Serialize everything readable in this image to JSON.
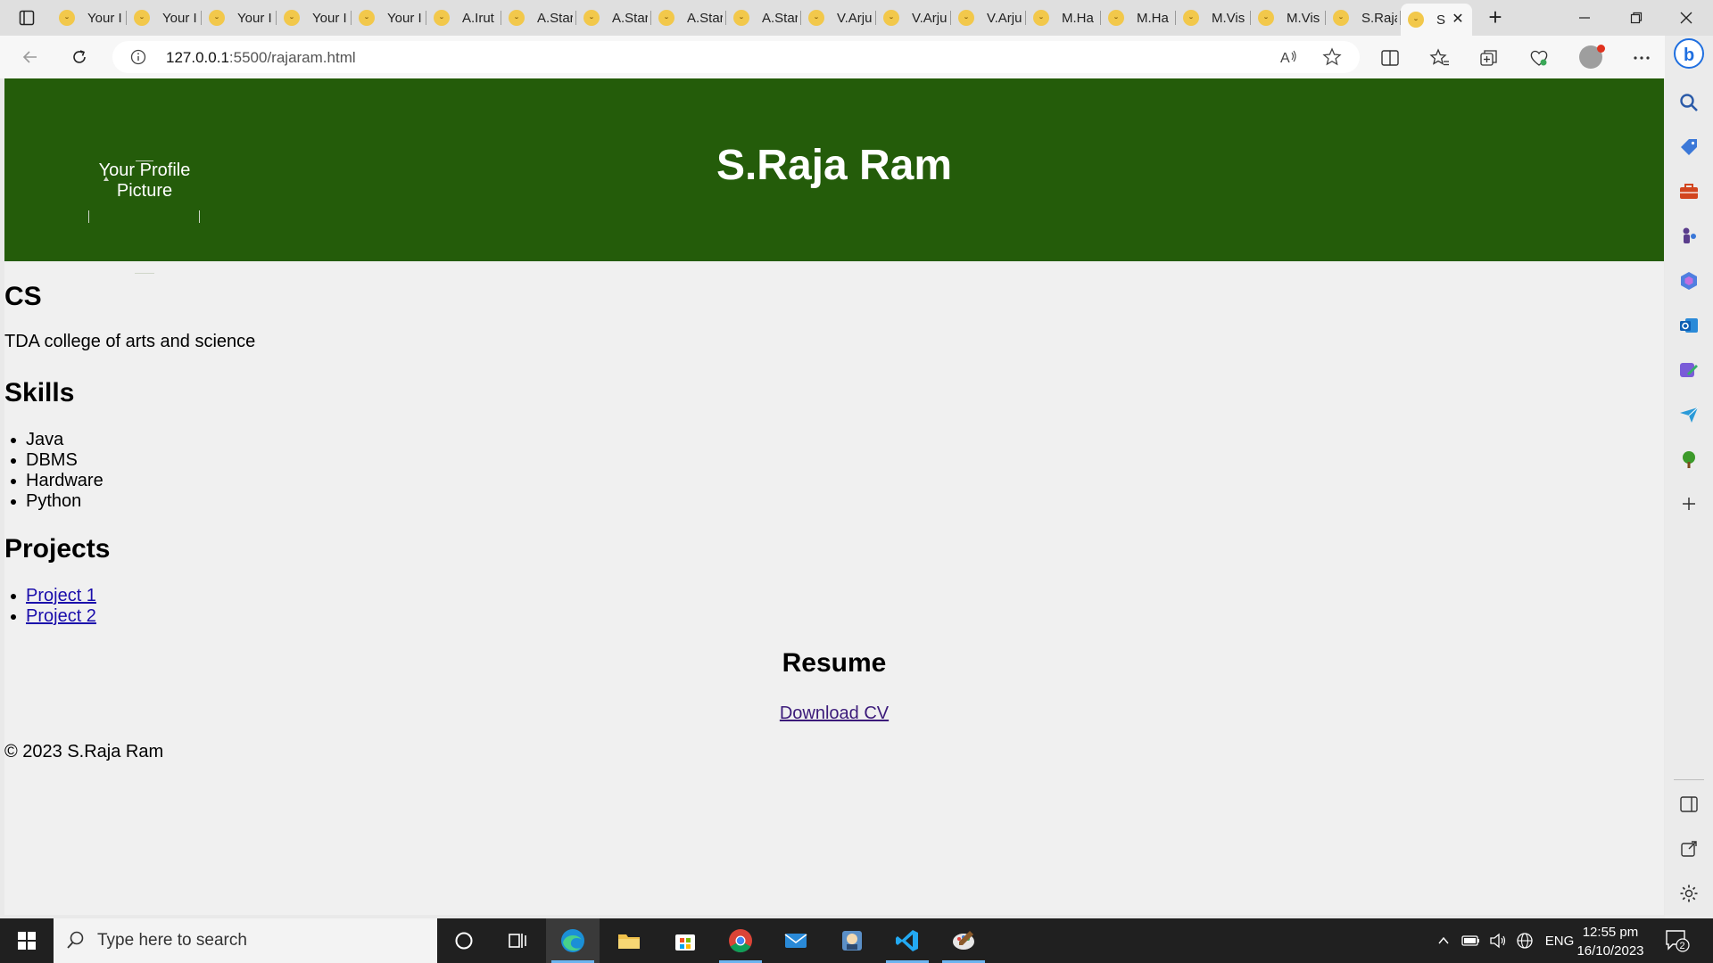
{
  "tabs": [
    {
      "label": "Your I"
    },
    {
      "label": "Your I"
    },
    {
      "label": "Your I"
    },
    {
      "label": "Your I"
    },
    {
      "label": "Your I"
    },
    {
      "label": "A.Irut"
    },
    {
      "label": "A.Star"
    },
    {
      "label": "A.Star"
    },
    {
      "label": "A.Star"
    },
    {
      "label": "A.Star"
    },
    {
      "label": "V.Arju"
    },
    {
      "label": "V.Arju"
    },
    {
      "label": "V.Arju"
    },
    {
      "label": "M.Ha"
    },
    {
      "label": "M.Ha"
    },
    {
      "label": "M.Vis"
    },
    {
      "label": "M.Vis"
    },
    {
      "label": "S.Raja"
    },
    {
      "label": "S"
    }
  ],
  "address_bar": {
    "host": "127.0.0.1",
    "path": ":5500/rajaram.html"
  },
  "page": {
    "title": "S.Raja Ram",
    "profile_picture_alt": "Your Profile Picture",
    "department": "CS",
    "college": "TDA college of arts and science",
    "skills_heading": "Skills",
    "skills": [
      "Java",
      "DBMS",
      "Hardware",
      "Python"
    ],
    "projects_heading": "Projects",
    "projects": [
      "Project 1",
      "Project 2"
    ],
    "resume_heading": "Resume",
    "download_cv": "Download CV",
    "footer": "© 2023 S.Raja Ram"
  },
  "taskbar": {
    "search_placeholder": "Type here to search",
    "language": "ENG",
    "time": "12:55 pm",
    "date": "16/10/2023",
    "notification_count": "2"
  },
  "colors": {
    "header_bg": "#245c0a",
    "link": "#1a0dab",
    "visited_link": "#3b1a7a"
  }
}
